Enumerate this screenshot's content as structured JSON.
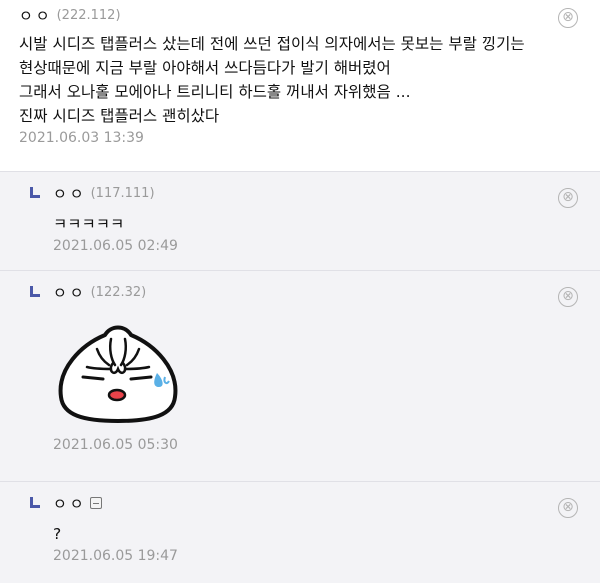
{
  "main_comment": {
    "nick": "ㅇㅇ",
    "ip": "(222.112)",
    "body_lines": [
      "시발 시디즈 탭플러스 샀는데 전에 쓰던 접이식 의자에서는 못보는 부랄 낑기는",
      "현상때문에 지금 부랄 아야해서 쓰다듬다가 발기 해버렸어",
      "그래서 오나홀 모에아나 트리니티 하드홀 꺼내서 자위했음 ...",
      "진짜 시디즈 탭플러스 괜히샀다"
    ],
    "date": "2021.06.03 13:39"
  },
  "replies": [
    {
      "nick": "ㅇㅇ",
      "ip": "(117.111)",
      "body": "ㅋㅋㅋㅋㅋ",
      "date": "2021.06.05 02:49"
    },
    {
      "nick": "ㅇㅇ",
      "ip": "(122.32)",
      "sticker": "dumpling-sticker-icon",
      "date": "2021.06.05 05:30"
    },
    {
      "nick": "ㅇㅇ",
      "memo_icon": "memo-icon",
      "body": "?",
      "date": "2021.06.05 19:47"
    }
  ],
  "icons": {
    "close": "⊗",
    "reply_arrow": "reply-arrow-icon"
  },
  "colors": {
    "reply_bg": "#f3f3f6",
    "arrow": "#4a58a8",
    "meta_gray": "#9a9a9a"
  }
}
